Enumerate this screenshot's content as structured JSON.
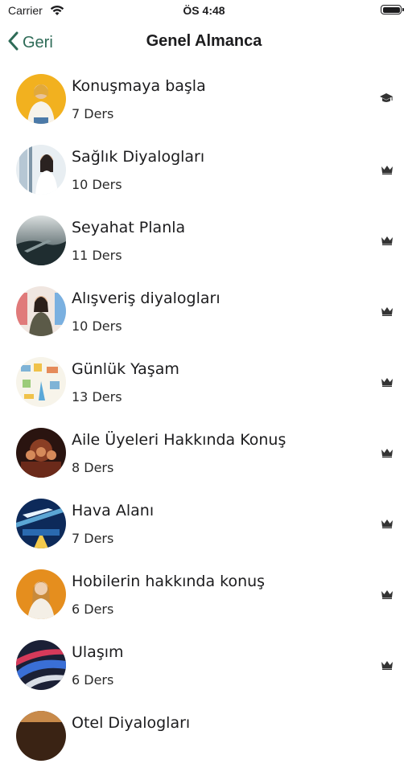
{
  "status_bar": {
    "carrier": "Carrier",
    "time": "ÖS 4:48"
  },
  "nav": {
    "back_label": "Geri",
    "title": "Genel Almanca"
  },
  "lessons": [
    {
      "title": "Konuşmaya başla",
      "count": "7 Ders",
      "icon": "graduation-cap-icon"
    },
    {
      "title": "Sağlık Diyalogları",
      "count": "10 Ders",
      "icon": "crown-icon"
    },
    {
      "title": "Seyahat Planla",
      "count": "11 Ders",
      "icon": "crown-icon"
    },
    {
      "title": "Alışveriş diyalogları",
      "count": "10 Ders",
      "icon": "crown-icon"
    },
    {
      "title": "Günlük Yaşam",
      "count": "13 Ders",
      "icon": "crown-icon"
    },
    {
      "title": "Aile Üyeleri Hakkında Konuş",
      "count": "8 Ders",
      "icon": "crown-icon"
    },
    {
      "title": "Hava Alanı",
      "count": "7 Ders",
      "icon": "crown-icon"
    },
    {
      "title": "Hobilerin hakkında konuş",
      "count": "6 Ders",
      "icon": "crown-icon"
    },
    {
      "title": "Ulaşım",
      "count": "6 Ders",
      "icon": "crown-icon"
    },
    {
      "title": "Otel Diyalogları",
      "count": "",
      "icon": ""
    }
  ],
  "colors": {
    "accent": "#2e6b57",
    "text": "#1c1c1e",
    "icon": "#333333"
  }
}
